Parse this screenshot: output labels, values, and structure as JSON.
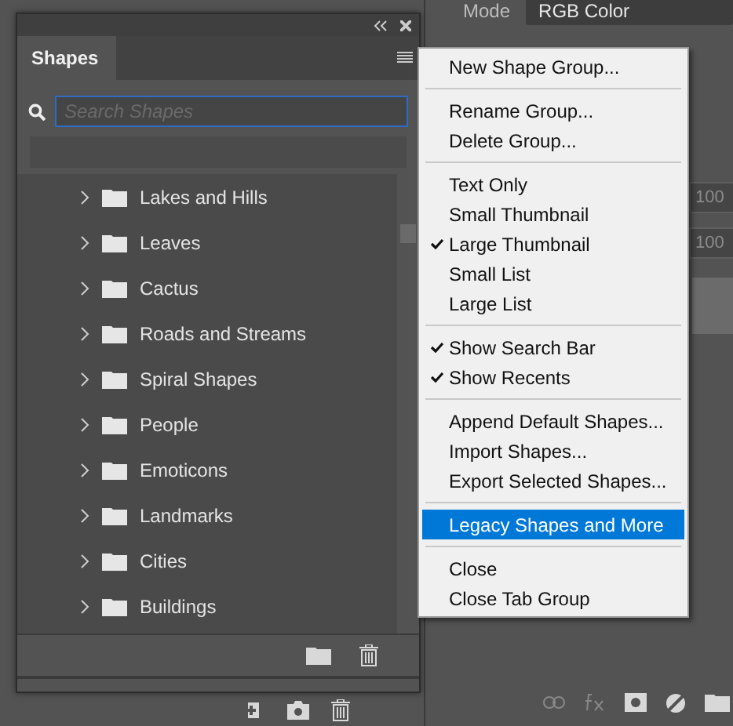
{
  "properties_panel": {
    "mode_label": "Mode",
    "mode_value": "RGB Color",
    "fields": [
      "100",
      "100"
    ]
  },
  "shapes_panel": {
    "tab": "Shapes",
    "search": {
      "placeholder": "Search Shapes"
    },
    "groups": [
      {
        "name": "Lakes and Hills"
      },
      {
        "name": "Leaves"
      },
      {
        "name": "Cactus"
      },
      {
        "name": "Roads and Streams"
      },
      {
        "name": "Spiral Shapes"
      },
      {
        "name": "People"
      },
      {
        "name": "Emoticons"
      },
      {
        "name": "Landmarks"
      },
      {
        "name": "Cities"
      },
      {
        "name": "Buildings"
      }
    ]
  },
  "menu": {
    "sections": [
      [
        {
          "label": "New Shape Group...",
          "checked": false,
          "selected": false
        }
      ],
      [
        {
          "label": "Rename Group...",
          "checked": false,
          "selected": false
        },
        {
          "label": "Delete Group...",
          "checked": false,
          "selected": false
        }
      ],
      [
        {
          "label": "Text Only",
          "checked": false,
          "selected": false
        },
        {
          "label": "Small Thumbnail",
          "checked": false,
          "selected": false
        },
        {
          "label": "Large Thumbnail",
          "checked": true,
          "selected": false
        },
        {
          "label": "Small List",
          "checked": false,
          "selected": false
        },
        {
          "label": "Large List",
          "checked": false,
          "selected": false
        }
      ],
      [
        {
          "label": "Show Search Bar",
          "checked": true,
          "selected": false
        },
        {
          "label": "Show Recents",
          "checked": true,
          "selected": false
        }
      ],
      [
        {
          "label": "Append Default Shapes...",
          "checked": false,
          "selected": false
        },
        {
          "label": "Import Shapes...",
          "checked": false,
          "selected": false
        },
        {
          "label": "Export Selected Shapes...",
          "checked": false,
          "selected": false
        }
      ],
      [
        {
          "label": "Legacy Shapes and More",
          "checked": false,
          "selected": true
        }
      ],
      [
        {
          "label": "Close",
          "checked": false,
          "selected": false
        },
        {
          "label": "Close Tab Group",
          "checked": false,
          "selected": false
        }
      ]
    ]
  }
}
